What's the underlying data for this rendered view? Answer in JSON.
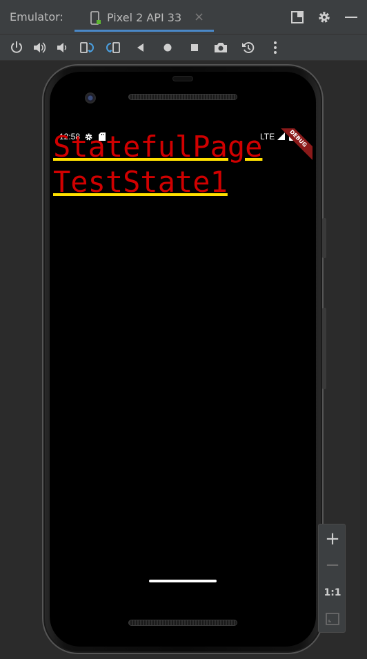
{
  "titlebar": {
    "label": "Emulator:",
    "tab_label": "Pixel 2 API 33",
    "close_glyph": "×"
  },
  "toolbar": {
    "icons": [
      "power-icon",
      "volume-up-icon",
      "volume-down-icon",
      "rotate-left-icon",
      "rotate-right-icon",
      "back-icon",
      "home-icon",
      "overview-icon",
      "camera-icon",
      "snapshot-icon",
      "more-icon"
    ]
  },
  "device": {
    "status_time": "12:58",
    "network": "LTE",
    "debug_banner": "DEBUG"
  },
  "app": {
    "line1": "StatefulPage",
    "line2": "TestState1"
  },
  "zoom": {
    "plus": "+",
    "minus": "−",
    "one_to_one": "1:1"
  },
  "colors": {
    "ide_bg": "#2b2b2b",
    "toolbar_bg": "#3c3f41",
    "accent": "#4a88c7",
    "text_red": "#d00000",
    "underline_yellow": "#ffe000",
    "debug_banner": "#8b1a1a"
  }
}
